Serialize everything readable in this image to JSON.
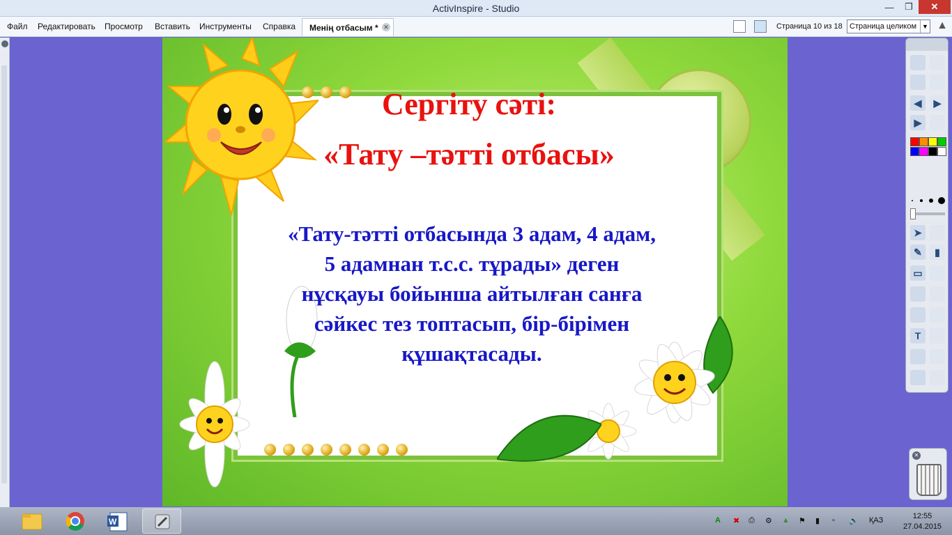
{
  "window": {
    "title": "ActivInspire - Studio"
  },
  "menu": {
    "items": [
      "Файл",
      "Редактировать",
      "Просмотр",
      "Вставить",
      "Инструменты",
      "Справка"
    ],
    "doc_tab": "Менің отбасым *",
    "page_info": "Страница 10 из 18",
    "zoom": "Страница целиком"
  },
  "slide": {
    "title_line1": "Сергіту сәті:",
    "title_line2": "«Тату –тәтті отбасы»",
    "body": "«Тату-тәтті отбасында 3 адам, 4 адам, 5 адамнан т.с.с. тұрады» деген нұсқауы бойынша айтылған санға сәйкес тез топтасып, бір-бірімен құшақтасады.",
    "colors": {
      "title": "#e8120f",
      "body": "#1717c8",
      "background": "#8fd93c",
      "frame": "#7cc23a"
    }
  },
  "toolbox": {
    "palette": [
      "#ff0000",
      "#ff8c00",
      "#ffff00",
      "#00cc00",
      "#0000ff",
      "#ff00ff",
      "#000000",
      "#ffffff"
    ],
    "icons": [
      "main-menu-icon",
      "page-browser-icon",
      "desktop-annotate-icon",
      "toolbox-settings-icon",
      "previous-page-icon",
      "next-page-icon",
      "play-icon",
      "reset-icon",
      "select-icon",
      "tools-icon",
      "pen-icon",
      "highlighter-icon",
      "eraser-icon",
      "fill-icon",
      "shape-icon",
      "connector-icon",
      "camera-icon",
      "media-icon",
      "text-icon",
      "grid-icon",
      "handwriting-icon",
      "read-icon",
      "web-icon",
      "spell-icon",
      "flask-icon",
      "refresh-icon",
      "undo-icon",
      "redo-icon"
    ]
  },
  "taskbar": {
    "language": "ҚАЗ",
    "time": "12:55",
    "date": "27.04.2015"
  }
}
